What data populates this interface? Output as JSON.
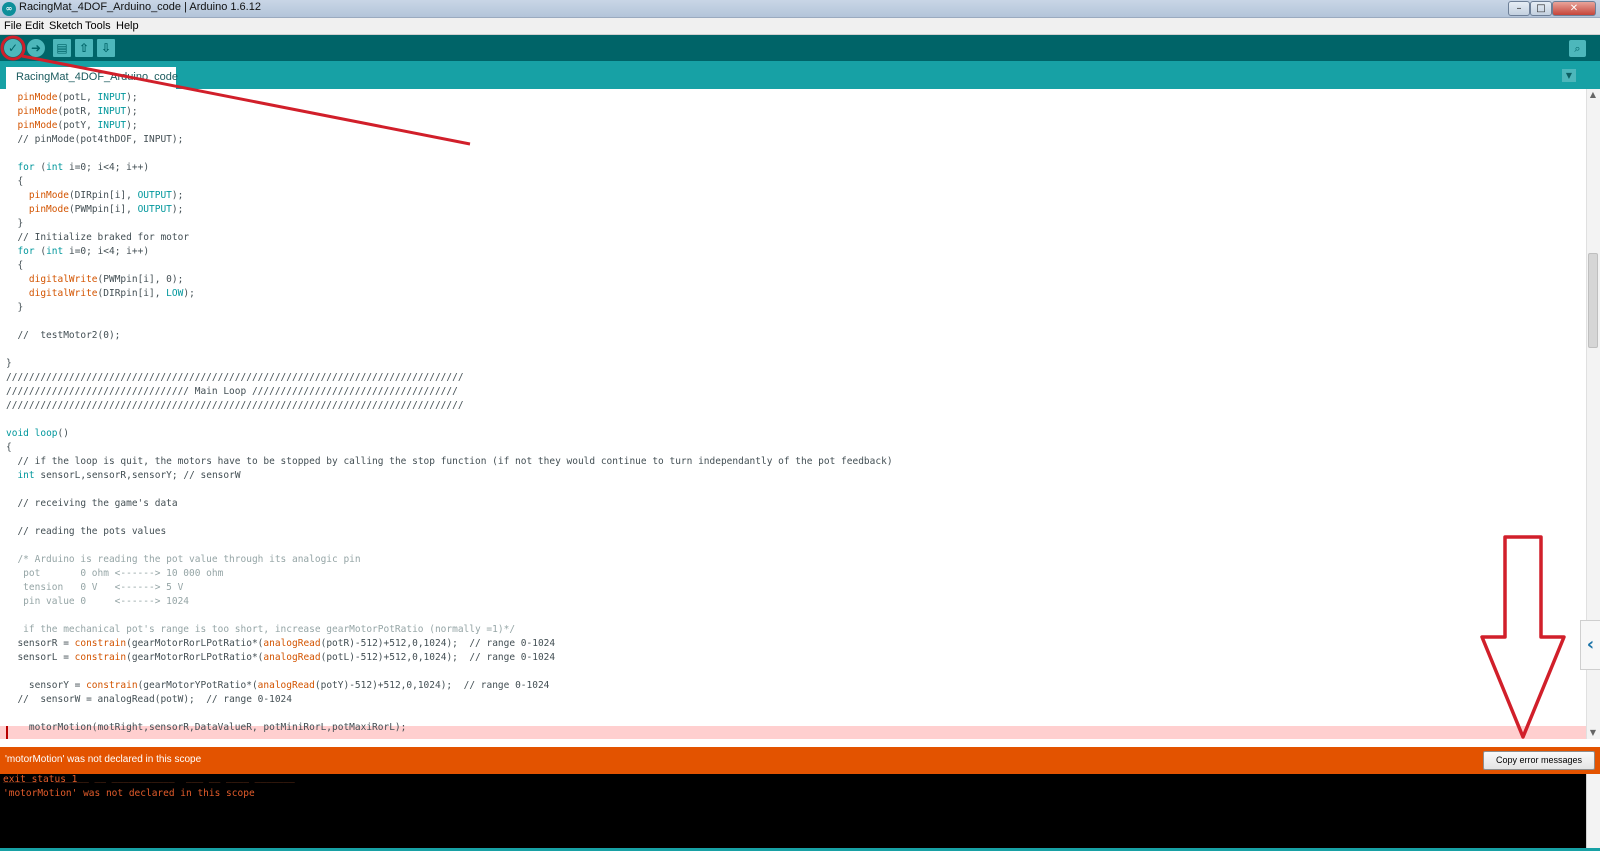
{
  "window": {
    "title": "RacingMat_4DOF_Arduino_code | Arduino 1.6.12",
    "app_icon": "arduino-logo-icon",
    "controls": [
      "minimize-icon",
      "maximize-icon",
      "close-icon"
    ]
  },
  "menu": {
    "items": [
      "File",
      "Edit",
      "Sketch",
      "Tools",
      "Help"
    ]
  },
  "toolbar": {
    "buttons": [
      {
        "name": "verify",
        "icon": "check-icon"
      },
      {
        "name": "upload",
        "icon": "arrow-right-icon"
      },
      {
        "name": "new",
        "icon": "document-icon"
      },
      {
        "name": "open",
        "icon": "arrow-up-icon"
      },
      {
        "name": "save",
        "icon": "arrow-down-icon"
      }
    ],
    "serial_monitor_icon": "magnifier-icon"
  },
  "tabs": {
    "active": "RacingMat_4DOF_Arduino_code",
    "menu_icon": "chevron-down-icon"
  },
  "editor": {
    "lines": [
      "  pinMode(potL, INPUT);",
      "  pinMode(potR, INPUT);",
      "  pinMode(potY, INPUT);",
      "  // pinMode(pot4thDOF, INPUT);",
      "",
      "  for (int i=0; i<4; i++)",
      "  {",
      "    pinMode(DIRpin[i], OUTPUT);",
      "    pinMode(PWMpin[i], OUTPUT);",
      "  }",
      "  // Initialize braked for motor",
      "  for (int i=0; i<4; i++)",
      "  {",
      "    digitalWrite(PWMpin[i], 0);",
      "    digitalWrite(DIRpin[i], LOW);",
      "  }",
      "",
      "  //  testMotor2(0);",
      "",
      "}",
      "////////////////////////////////////////////////////////////////////////////////",
      "//////////////////////////////// Main Loop ////////////////////////////////////",
      "////////////////////////////////////////////////////////////////////////////////",
      "",
      "void loop()",
      "{",
      "  // if the loop is quit, the motors have to be stopped by calling the stop function (if not they would continue to turn independantly of the pot feedback)",
      "  int sensorL,sensorR,sensorY; // sensorW",
      "",
      "  // receiving the game's data",
      "",
      "  // reading the pots values",
      "",
      "  /* Arduino is reading the pot value through its analogic pin",
      "   pot       0 ohm <------> 10 000 ohm",
      "   tension   0 V   <------> 5 V",
      "   pin value 0     <------> 1024",
      "",
      "   if the mechanical pot's range is too short, increase gearMotorPotRatio (normally =1)*/",
      "  sensorR = constrain(gearMotorRorLPotRatio*(analogRead(potR)-512)+512,0,1024);  // range 0-1024",
      "  sensorL = constrain(gearMotorRorLPotRatio*(analogRead(potL)-512)+512,0,1024);  // range 0-1024",
      "",
      "    sensorY = constrain(gearMotorYPotRatio*(analogRead(potY)-512)+512,0,1024);  // range 0-1024",
      "  //  sensorW = analogRead(potW);  // range 0-1024",
      "",
      "    motorMotion(motRight,sensorR,DataValueR, potMiniRorL,potMaxiRorL);"
    ],
    "error_line_index": 45
  },
  "error_bar": {
    "message": "'motorMotion' was not declared in this scope",
    "copy_button": "Copy error messages"
  },
  "console": {
    "lines": [
      "exit status 1",
      "'motorMotion' was not declared in this scope"
    ]
  },
  "colors": {
    "toolbar": "#006468",
    "tabstrip": "#17a1a5",
    "error_bar": "#e35300",
    "keyword": "#d35400",
    "constant": "#00979c",
    "annotation": "#d11f2a"
  }
}
